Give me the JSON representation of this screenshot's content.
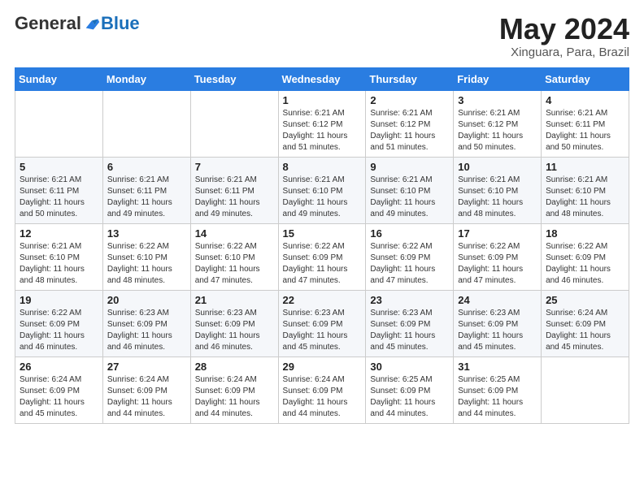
{
  "logo": {
    "general": "General",
    "blue": "Blue"
  },
  "title": "May 2024",
  "subtitle": "Xinguara, Para, Brazil",
  "days_of_week": [
    "Sunday",
    "Monday",
    "Tuesday",
    "Wednesday",
    "Thursday",
    "Friday",
    "Saturday"
  ],
  "weeks": [
    [
      {
        "day": "",
        "info": ""
      },
      {
        "day": "",
        "info": ""
      },
      {
        "day": "",
        "info": ""
      },
      {
        "day": "1",
        "info": "Sunrise: 6:21 AM\nSunset: 6:12 PM\nDaylight: 11 hours and 51 minutes."
      },
      {
        "day": "2",
        "info": "Sunrise: 6:21 AM\nSunset: 6:12 PM\nDaylight: 11 hours and 51 minutes."
      },
      {
        "day": "3",
        "info": "Sunrise: 6:21 AM\nSunset: 6:12 PM\nDaylight: 11 hours and 50 minutes."
      },
      {
        "day": "4",
        "info": "Sunrise: 6:21 AM\nSunset: 6:11 PM\nDaylight: 11 hours and 50 minutes."
      }
    ],
    [
      {
        "day": "5",
        "info": "Sunrise: 6:21 AM\nSunset: 6:11 PM\nDaylight: 11 hours and 50 minutes."
      },
      {
        "day": "6",
        "info": "Sunrise: 6:21 AM\nSunset: 6:11 PM\nDaylight: 11 hours and 49 minutes."
      },
      {
        "day": "7",
        "info": "Sunrise: 6:21 AM\nSunset: 6:11 PM\nDaylight: 11 hours and 49 minutes."
      },
      {
        "day": "8",
        "info": "Sunrise: 6:21 AM\nSunset: 6:10 PM\nDaylight: 11 hours and 49 minutes."
      },
      {
        "day": "9",
        "info": "Sunrise: 6:21 AM\nSunset: 6:10 PM\nDaylight: 11 hours and 49 minutes."
      },
      {
        "day": "10",
        "info": "Sunrise: 6:21 AM\nSunset: 6:10 PM\nDaylight: 11 hours and 48 minutes."
      },
      {
        "day": "11",
        "info": "Sunrise: 6:21 AM\nSunset: 6:10 PM\nDaylight: 11 hours and 48 minutes."
      }
    ],
    [
      {
        "day": "12",
        "info": "Sunrise: 6:21 AM\nSunset: 6:10 PM\nDaylight: 11 hours and 48 minutes."
      },
      {
        "day": "13",
        "info": "Sunrise: 6:22 AM\nSunset: 6:10 PM\nDaylight: 11 hours and 48 minutes."
      },
      {
        "day": "14",
        "info": "Sunrise: 6:22 AM\nSunset: 6:10 PM\nDaylight: 11 hours and 47 minutes."
      },
      {
        "day": "15",
        "info": "Sunrise: 6:22 AM\nSunset: 6:09 PM\nDaylight: 11 hours and 47 minutes."
      },
      {
        "day": "16",
        "info": "Sunrise: 6:22 AM\nSunset: 6:09 PM\nDaylight: 11 hours and 47 minutes."
      },
      {
        "day": "17",
        "info": "Sunrise: 6:22 AM\nSunset: 6:09 PM\nDaylight: 11 hours and 47 minutes."
      },
      {
        "day": "18",
        "info": "Sunrise: 6:22 AM\nSunset: 6:09 PM\nDaylight: 11 hours and 46 minutes."
      }
    ],
    [
      {
        "day": "19",
        "info": "Sunrise: 6:22 AM\nSunset: 6:09 PM\nDaylight: 11 hours and 46 minutes."
      },
      {
        "day": "20",
        "info": "Sunrise: 6:23 AM\nSunset: 6:09 PM\nDaylight: 11 hours and 46 minutes."
      },
      {
        "day": "21",
        "info": "Sunrise: 6:23 AM\nSunset: 6:09 PM\nDaylight: 11 hours and 46 minutes."
      },
      {
        "day": "22",
        "info": "Sunrise: 6:23 AM\nSunset: 6:09 PM\nDaylight: 11 hours and 45 minutes."
      },
      {
        "day": "23",
        "info": "Sunrise: 6:23 AM\nSunset: 6:09 PM\nDaylight: 11 hours and 45 minutes."
      },
      {
        "day": "24",
        "info": "Sunrise: 6:23 AM\nSunset: 6:09 PM\nDaylight: 11 hours and 45 minutes."
      },
      {
        "day": "25",
        "info": "Sunrise: 6:24 AM\nSunset: 6:09 PM\nDaylight: 11 hours and 45 minutes."
      }
    ],
    [
      {
        "day": "26",
        "info": "Sunrise: 6:24 AM\nSunset: 6:09 PM\nDaylight: 11 hours and 45 minutes."
      },
      {
        "day": "27",
        "info": "Sunrise: 6:24 AM\nSunset: 6:09 PM\nDaylight: 11 hours and 44 minutes."
      },
      {
        "day": "28",
        "info": "Sunrise: 6:24 AM\nSunset: 6:09 PM\nDaylight: 11 hours and 44 minutes."
      },
      {
        "day": "29",
        "info": "Sunrise: 6:24 AM\nSunset: 6:09 PM\nDaylight: 11 hours and 44 minutes."
      },
      {
        "day": "30",
        "info": "Sunrise: 6:25 AM\nSunset: 6:09 PM\nDaylight: 11 hours and 44 minutes."
      },
      {
        "day": "31",
        "info": "Sunrise: 6:25 AM\nSunset: 6:09 PM\nDaylight: 11 hours and 44 minutes."
      },
      {
        "day": "",
        "info": ""
      }
    ]
  ],
  "colors": {
    "header_bg": "#2a7de1",
    "accent_blue": "#1a6fba"
  }
}
